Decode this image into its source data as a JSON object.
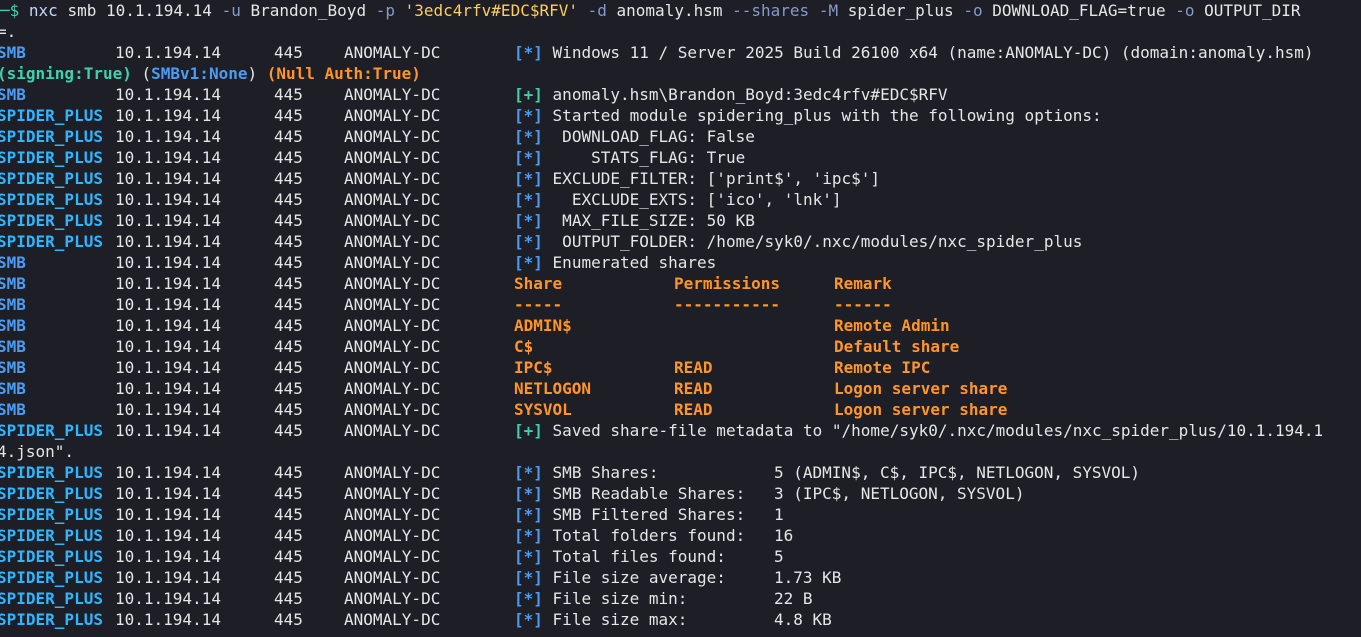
{
  "command": {
    "prompt": "─$",
    "program": "nxc",
    "args_plain1": " smb 10.1.194.14 ",
    "flag_u": "-u",
    "user": " Brandon_Boyd ",
    "flag_p": "-p",
    "password": " '3edc4rfv#EDC$RFV' ",
    "flag_d": "-d",
    "domain": " anomaly.hsm ",
    "flag_shares": "--shares",
    "sp1": " ",
    "flag_M": "-M",
    "module": " spider_plus ",
    "flag_o1": "-o",
    "opt1": " DOWNLOAD_FLAG=true ",
    "flag_o2": "-o",
    "opt2": " OUTPUT_DIR",
    "wrap": "=."
  },
  "colors": {
    "background": "#1d1e26",
    "orange": "#ff9428",
    "teal": "#3fd1a9",
    "blue": "#4d9cf4"
  },
  "host": {
    "ip": "10.1.194.14",
    "port": "445",
    "name": "ANOMALY-DC"
  },
  "proto": {
    "smb": "SMB",
    "spider": "SPIDER_PLUS"
  },
  "marks": {
    "info": "[*]",
    "ok": "[+]"
  },
  "lines": {
    "os": "Windows 11 / Server 2025 Build 26100 x64 (name:ANOMALY-DC) (domain:anomaly.hsm)",
    "signing": "(signing:True)",
    "smbv1": "SMBv1:None",
    "nullauth": "(Null Auth:True)",
    "auth": "anomaly.hsm\\Brandon_Boyd:3edc4rfv#EDC$RFV",
    "started": "Started module spidering_plus with the following options:",
    "download_flag": " DOWNLOAD_FLAG: False",
    "stats_flag": "    STATS_FLAG: True",
    "exclude_filter": "EXCLUDE_FILTER: ['print$', 'ipc$']",
    "exclude_exts": "  EXCLUDE_EXTS: ['ico', 'lnk']",
    "max_file_size": " MAX_FILE_SIZE: 50 KB",
    "output_folder": " OUTPUT_FOLDER: /home/syk0/.nxc/modules/nxc_spider_plus",
    "enumerated": "Enumerated shares",
    "saved": "Saved share-file metadata to \"/home/syk0/.nxc/modules/nxc_spider_plus/10.1.194.1",
    "saved_wrap": "4.json\"."
  },
  "share_table": {
    "headers": [
      "Share",
      "Permissions",
      "Remark"
    ],
    "underlines": [
      "-----",
      "-----------",
      "------"
    ],
    "rows": [
      {
        "share": "ADMIN$",
        "perm": "",
        "remark": "Remote Admin"
      },
      {
        "share": "C$",
        "perm": "",
        "remark": "Default share"
      },
      {
        "share": "IPC$",
        "perm": "READ",
        "remark": "Remote IPC"
      },
      {
        "share": "NETLOGON",
        "perm": "READ",
        "remark": "Logon server share"
      },
      {
        "share": "SYSVOL",
        "perm": "READ",
        "remark": "Logon server share"
      }
    ]
  },
  "stats": [
    {
      "label": "SMB Shares:",
      "value": "5 (ADMIN$, C$, IPC$, NETLOGON, SYSVOL)"
    },
    {
      "label": "SMB Readable Shares:",
      "value": "3 (IPC$, NETLOGON, SYSVOL)"
    },
    {
      "label": "SMB Filtered Shares:",
      "value": "1"
    },
    {
      "label": "Total folders found:",
      "value": "16"
    },
    {
      "label": "Total files found:",
      "value": "5"
    },
    {
      "label": "File size average:",
      "value": "1.73 KB"
    },
    {
      "label": "File size min:",
      "value": "22 B"
    },
    {
      "label": "File size max:",
      "value": "4.8 KB"
    }
  ]
}
